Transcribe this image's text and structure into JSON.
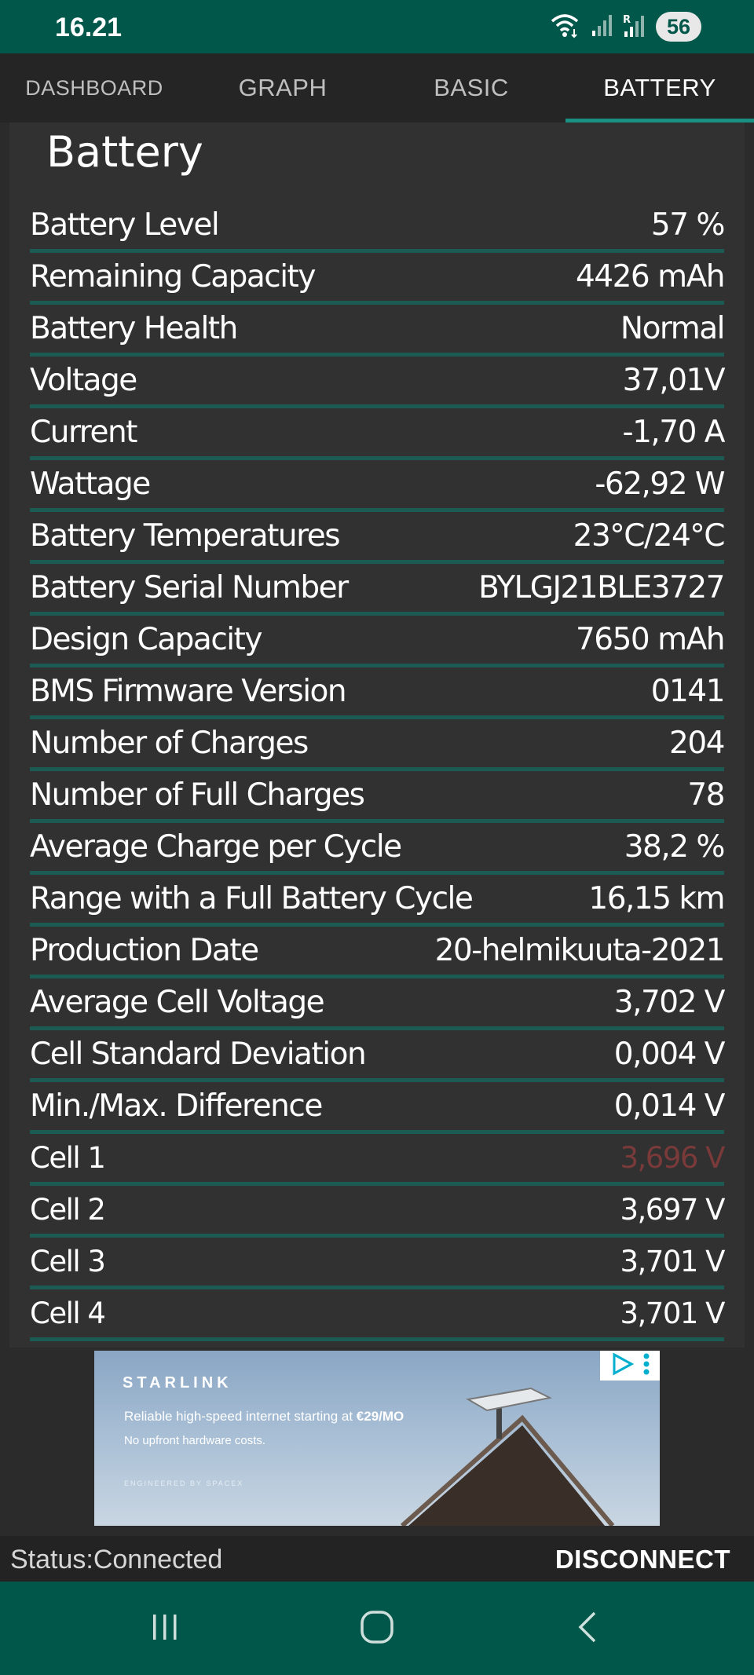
{
  "status_bar": {
    "time": "16.21",
    "battery_percent": "56",
    "icons": [
      "wifi-icon",
      "signal-icon",
      "signal-roaming-icon"
    ]
  },
  "tabs": [
    {
      "label": "DASHBOARD",
      "active": false
    },
    {
      "label": "GRAPH",
      "active": false
    },
    {
      "label": "BASIC",
      "active": false
    },
    {
      "label": "BATTERY",
      "active": true
    }
  ],
  "section": {
    "title": "Battery"
  },
  "rows": [
    {
      "label": "Battery Level",
      "value": "57 %"
    },
    {
      "label": "Remaining Capacity",
      "value": "4426 mAh"
    },
    {
      "label": "Battery Health",
      "value": "Normal"
    },
    {
      "label": "Voltage",
      "value": "37,01V"
    },
    {
      "label": "Current",
      "value": "-1,70 A"
    },
    {
      "label": "Wattage",
      "value": "-62,92 W"
    },
    {
      "label": "Battery Temperatures",
      "value": "23°C/24°C"
    },
    {
      "label": "Battery Serial Number",
      "value": "BYLGJ21BLE3727"
    },
    {
      "label": "Design Capacity",
      "value": "7650 mAh"
    },
    {
      "label": "BMS Firmware Version",
      "value": "0141"
    },
    {
      "label": "Number of Charges",
      "value": "204"
    },
    {
      "label": "Number of Full Charges",
      "value": "78"
    },
    {
      "label": "Average Charge per Cycle",
      "value": "38,2 %"
    },
    {
      "label": "Range with a Full Battery Cycle",
      "value": "16,15 km"
    },
    {
      "label": "Production Date",
      "value": "20-helmikuuta-2021"
    },
    {
      "label": "Average Cell Voltage",
      "value": "3,702 V"
    },
    {
      "label": "Cell Standard Deviation",
      "value": "0,004 V"
    },
    {
      "label": "Min./Max. Difference",
      "value": "0,014 V"
    },
    {
      "label": "Cell 1",
      "value": "3,696 V"
    },
    {
      "label": "Cell 2",
      "value": "3,697 V"
    },
    {
      "label": "Cell 3",
      "value": "3,701 V"
    },
    {
      "label": "Cell 4",
      "value": "3,701 V"
    }
  ],
  "ad": {
    "brand": "STARLINK",
    "line1_prefix": "Reliable high-speed internet starting at ",
    "line1_price": "€29/MO",
    "line2": "No upfront hardware costs.",
    "fine": "ENGINEERED BY SPACEX"
  },
  "footer": {
    "status": "Status:Connected",
    "disconnect_label": "DISCONNECT"
  },
  "colors": {
    "accent": "#00574a",
    "tab_indicator": "#1a8f83",
    "row_divider": "#1c5b54",
    "warning_value": "#7a3a3a"
  }
}
